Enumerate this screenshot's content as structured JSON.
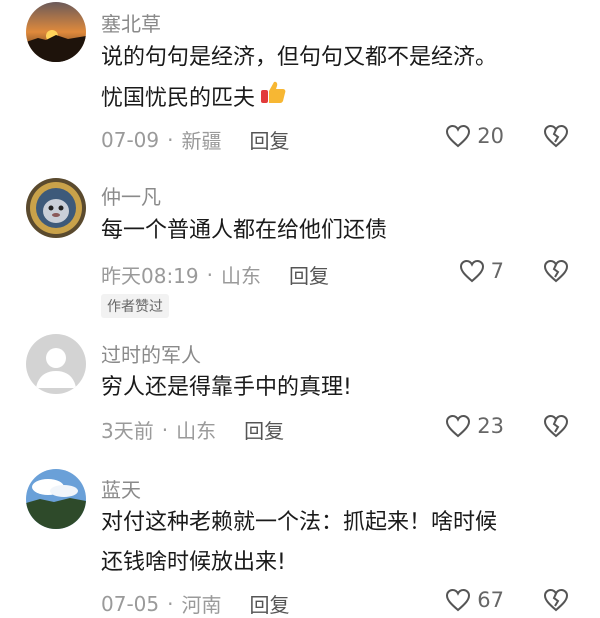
{
  "comments": [
    {
      "username": "塞北草",
      "text": "说的句句是经济，但句句又都不是经济。\n忧国忧民的匹夫",
      "date": "07-09",
      "location": "新疆",
      "reply": "回复",
      "likes": "20",
      "avatar_icon": "sunset-avatar"
    },
    {
      "username": "仲一凡",
      "text": "每一个普通人都在给他们还债",
      "date": "昨天08:19",
      "location": "山东",
      "reply": "回复",
      "likes": "7",
      "badge": "作者赞过",
      "avatar_icon": "cartoon-avatar"
    },
    {
      "username": "过时的军人",
      "text": "穷人还是得靠手中的真理!",
      "date": "3天前",
      "location": "山东",
      "reply": "回复",
      "likes": "23",
      "avatar_icon": "default-avatar"
    },
    {
      "username": "蓝天",
      "text": "对付这种老赖就一个法：抓起来！啥时候\n还钱啥时候放出来!",
      "date": "07-05",
      "location": "河南",
      "reply": "回复",
      "likes": "67",
      "avatar_icon": "sky-avatar"
    }
  ],
  "dot": "·",
  "emoji": "thumbs-up-icon"
}
